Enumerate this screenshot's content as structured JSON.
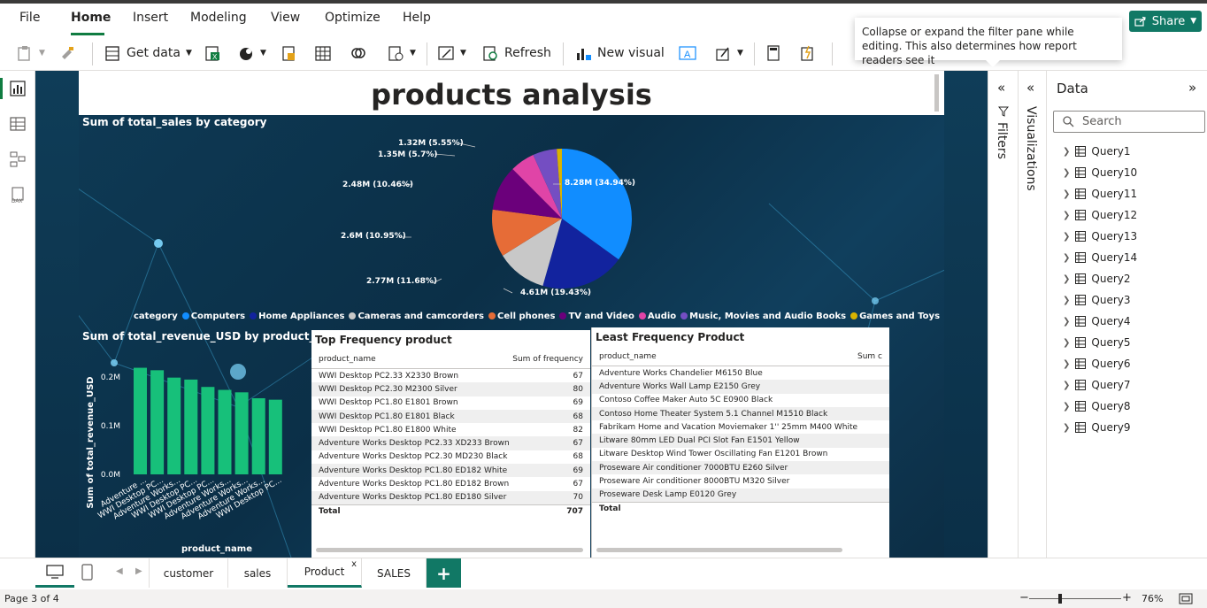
{
  "menu": {
    "file": "File",
    "home": "Home",
    "insert": "Insert",
    "modeling": "Modeling",
    "view": "View",
    "optimize": "Optimize",
    "help": "Help",
    "share": "Share"
  },
  "ribbon": {
    "get_data": "Get data",
    "refresh": "Refresh",
    "new_visual": "New visual"
  },
  "tooltip": "Collapse or expand the filter pane while editing. This also determines how report readers see it",
  "report": {
    "title": "products analysis"
  },
  "pie": {
    "title": "Sum of total_sales by category",
    "legend_title": "category",
    "labels": [
      "8.28M (34.94%)",
      "4.61M (19.43%)",
      "2.77M (11.68%)",
      "2.6M (10.95%)",
      "2.48M (10.46%)",
      "1.35M (5.7%)",
      "1.32M (5.55%)"
    ],
    "colors": {
      "computers": "#118dff",
      "home": "#12239e",
      "cameras": "#c8c8c8",
      "cell": "#e66c37",
      "tv": "#6b007b",
      "audio": "#e044a7",
      "music": "#744ec2",
      "games": "#d9b300"
    }
  },
  "chart_data": [
    {
      "type": "pie",
      "title": "Sum of total_sales by category",
      "categories": [
        "Computers",
        "Home Appliances",
        "Cameras and camcorders",
        "Cell phones",
        "TV and Video",
        "Audio",
        "Music, Movies and Audio Books",
        "Games and Toys"
      ],
      "values": [
        8.28,
        4.61,
        2.77,
        2.6,
        2.48,
        1.35,
        1.32,
        0.28
      ],
      "percent": [
        34.94,
        19.43,
        11.68,
        10.95,
        10.46,
        5.7,
        5.55,
        1.29
      ]
    },
    {
      "type": "bar",
      "title": "Sum of total_revenue_USD by product_name",
      "xlabel": "product_name",
      "ylabel": "Sum of total_revenue_USD",
      "ylim": [
        0,
        0.25
      ],
      "yticks": [
        "0.0M",
        "0.1M",
        "0.2M"
      ],
      "categories": [
        "Adventure ...",
        "WWI Desktop PC...",
        "Adventure Works...",
        "WWI Desktop PC...",
        "WWI Desktop PC...",
        "Adventure Works...",
        "Adventure Works...",
        "Adventure Works...",
        "WWI Desktop PC..."
      ],
      "values": [
        0.217,
        0.212,
        0.197,
        0.193,
        0.178,
        0.172,
        0.167,
        0.155,
        0.152
      ]
    }
  ],
  "top_table": {
    "title": "Top Frequency product",
    "col1": "product_name",
    "col2": "Sum of frequency",
    "rows": [
      [
        "WWI Desktop PC2.33 X2330 Brown",
        "67"
      ],
      [
        "WWI Desktop PC2.30 M2300 Silver",
        "80"
      ],
      [
        "WWI Desktop PC1.80 E1801 Brown",
        "69"
      ],
      [
        "WWI Desktop PC1.80 E1801 Black",
        "68"
      ],
      [
        "WWI Desktop PC1.80 E1800 White",
        "82"
      ],
      [
        "Adventure Works Desktop PC2.33 XD233 Brown",
        "67"
      ],
      [
        "Adventure Works Desktop PC2.30 MD230 Black",
        "68"
      ],
      [
        "Adventure Works Desktop PC1.80 ED182 White",
        "69"
      ],
      [
        "Adventure Works Desktop PC1.80 ED182 Brown",
        "67"
      ],
      [
        "Adventure Works Desktop PC1.80 ED180 Silver",
        "70"
      ]
    ],
    "total_label": "Total",
    "total_value": "707"
  },
  "least_table": {
    "title": "Least Frequency Product",
    "col1": "product_name",
    "col2": "Sum c",
    "rows": [
      "Adventure Works Chandelier M6150 Blue",
      "Adventure Works Wall Lamp E2150 Grey",
      "Contoso Coffee Maker Auto 5C E0900 Black",
      "Contoso Home Theater System 5.1 Channel M1510 Black",
      "Fabrikam Home and Vacation Moviemaker 1'' 25mm M400 White",
      "Litware 80mm LED Dual PCI Slot Fan E1501 Yellow",
      "Litware Desktop Wind Tower Oscillating Fan E1201 Brown",
      "Proseware Air conditioner 7000BTU E260 Silver",
      "Proseware Air conditioner 8000BTU M320 Silver",
      "Proseware Desk Lamp E0120 Grey"
    ],
    "total_label": "Total"
  },
  "panes": {
    "filters": "Filters",
    "visualizations": "Visualizations",
    "data": "Data",
    "search_placeholder": "Search"
  },
  "queries": [
    "Query1",
    "Query10",
    "Query11",
    "Query12",
    "Query13",
    "Query14",
    "Query2",
    "Query3",
    "Query4",
    "Query5",
    "Query6",
    "Query7",
    "Query8",
    "Query9"
  ],
  "tabs": [
    "customer",
    "sales",
    "Product",
    "SALES"
  ],
  "status": {
    "page": "Page 3 of 4",
    "zoom": "76%"
  }
}
